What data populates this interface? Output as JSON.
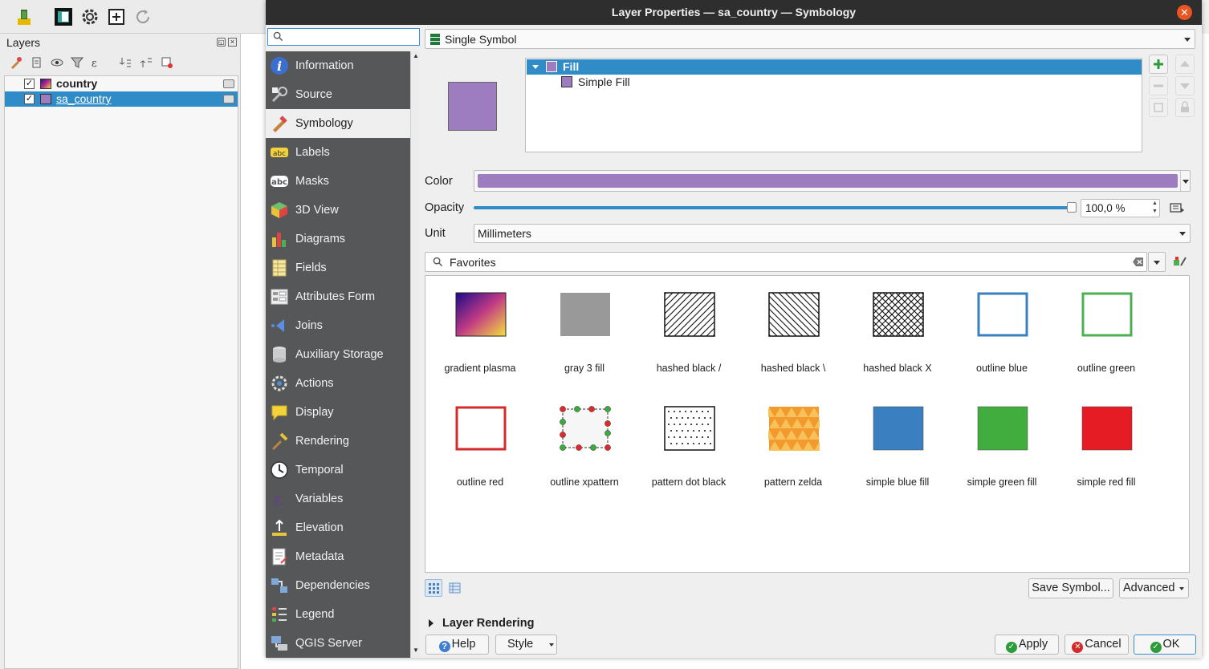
{
  "main_window": {
    "layers_panel": {
      "title": "Layers",
      "layers": [
        {
          "name": "country",
          "checked": true,
          "selected": false
        },
        {
          "name": "sa_country",
          "checked": true,
          "selected": true
        }
      ]
    }
  },
  "dialog": {
    "title": "Layer Properties — sa_country — Symbology",
    "search": {
      "placeholder": ""
    },
    "nav_items": [
      {
        "label": "Information",
        "icon": "information-icon"
      },
      {
        "label": "Source",
        "icon": "source-icon"
      },
      {
        "label": "Symbology",
        "icon": "symbology-icon",
        "active": true
      },
      {
        "label": "Labels",
        "icon": "labels-icon"
      },
      {
        "label": "Masks",
        "icon": "masks-icon"
      },
      {
        "label": "3D View",
        "icon": "3d-view-icon"
      },
      {
        "label": "Diagrams",
        "icon": "diagrams-icon"
      },
      {
        "label": "Fields",
        "icon": "fields-icon"
      },
      {
        "label": "Attributes Form",
        "icon": "attributes-form-icon"
      },
      {
        "label": "Joins",
        "icon": "joins-icon"
      },
      {
        "label": "Auxiliary Storage",
        "icon": "auxiliary-storage-icon"
      },
      {
        "label": "Actions",
        "icon": "actions-icon"
      },
      {
        "label": "Display",
        "icon": "display-icon"
      },
      {
        "label": "Rendering",
        "icon": "rendering-icon"
      },
      {
        "label": "Temporal",
        "icon": "temporal-icon"
      },
      {
        "label": "Variables",
        "icon": "variables-icon"
      },
      {
        "label": "Elevation",
        "icon": "elevation-icon"
      },
      {
        "label": "Metadata",
        "icon": "metadata-icon"
      },
      {
        "label": "Dependencies",
        "icon": "dependencies-icon"
      },
      {
        "label": "Legend",
        "icon": "legend-icon"
      },
      {
        "label": "QGIS Server",
        "icon": "qgis-server-icon"
      }
    ],
    "renderer": {
      "label": "Single Symbol"
    },
    "symbol_tree": {
      "fill_label": "Fill",
      "layer_label": "Simple Fill",
      "fill_color": "#9d7dbf"
    },
    "form": {
      "color_label": "Color",
      "color_value": "#9d7dbf",
      "opacity_label": "Opacity",
      "opacity_value": "100,0 %",
      "opacity_fraction": 1.0,
      "unit_label": "Unit",
      "unit_value": "Millimeters"
    },
    "favorites": {
      "label": "Favorites"
    },
    "symbols": [
      {
        "label": "gradient  plasma",
        "kind": "gradient"
      },
      {
        "label": "gray 3 fill",
        "kind": "gray"
      },
      {
        "label": "hashed black /",
        "kind": "hash-fwd"
      },
      {
        "label": "hashed black \\",
        "kind": "hash-back"
      },
      {
        "label": "hashed black X",
        "kind": "hash-x"
      },
      {
        "label": "outline blue",
        "kind": "outline",
        "color": "#3a7fbf"
      },
      {
        "label": "outline green",
        "kind": "outline",
        "color": "#4caf50"
      },
      {
        "label": "outline red",
        "kind": "outline",
        "color": "#d42a2a"
      },
      {
        "label": "outline xpattern",
        "kind": "xpattern"
      },
      {
        "label": "pattern dot black",
        "kind": "dots"
      },
      {
        "label": "pattern zelda",
        "kind": "zelda"
      },
      {
        "label": "simple blue fill",
        "kind": "fill",
        "color": "#3a7fbf"
      },
      {
        "label": "simple green fill",
        "kind": "fill",
        "color": "#41ad3e"
      },
      {
        "label": "simple red fill",
        "kind": "fill",
        "color": "#e61c24"
      }
    ],
    "buttons": {
      "save_symbol": "Save Symbol...",
      "advanced": "Advanced",
      "help": "Help",
      "style": "Style",
      "apply": "Apply",
      "cancel": "Cancel",
      "ok": "OK"
    },
    "layer_rendering": "Layer Rendering"
  }
}
